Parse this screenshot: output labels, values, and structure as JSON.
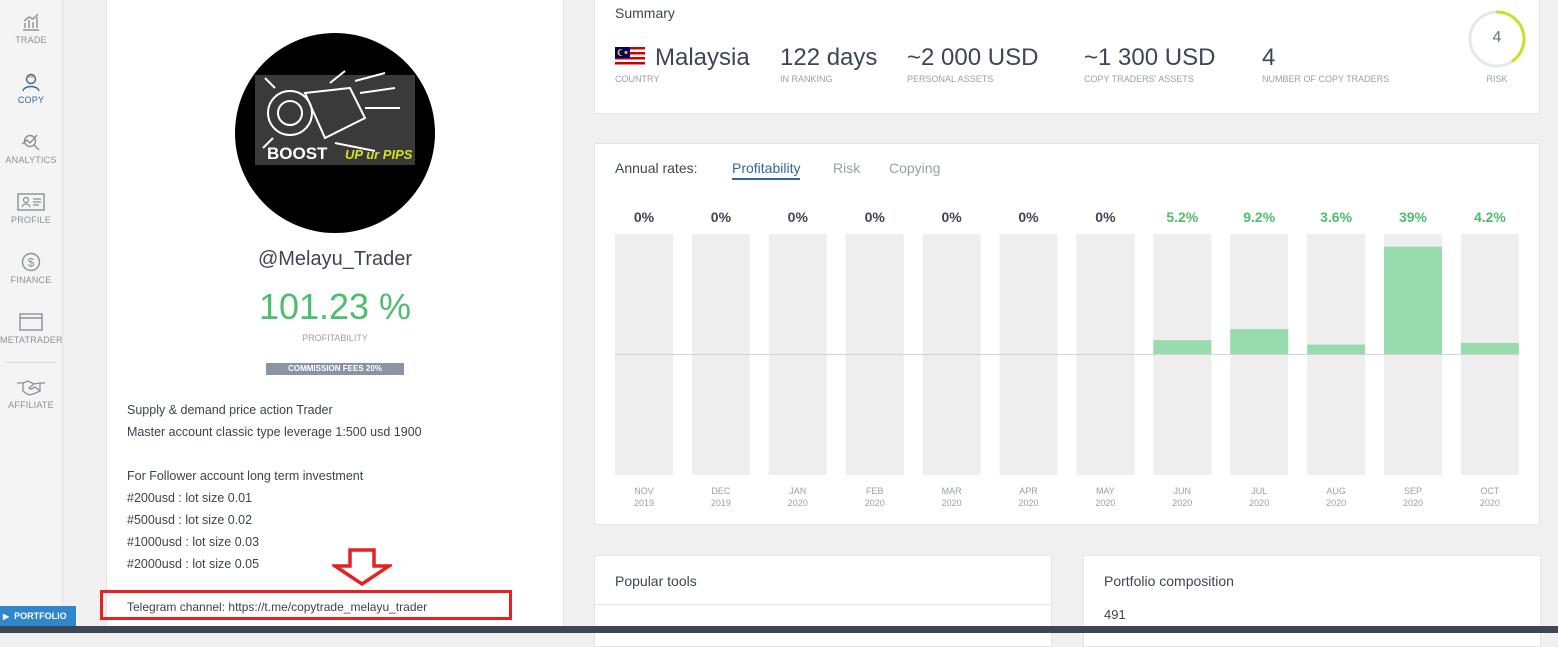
{
  "sidebar": {
    "items": [
      {
        "label": "TRADE",
        "icon": "chart-icon"
      },
      {
        "label": "COPY",
        "icon": "user-icon"
      },
      {
        "label": "ANALYTICS",
        "icon": "analytics-icon"
      },
      {
        "label": "PROFILE",
        "icon": "id-card-icon"
      },
      {
        "label": "FINANCE",
        "icon": "dollar-icon"
      },
      {
        "label": "METATRADER",
        "icon": "window-icon"
      },
      {
        "label": "AFFILIATE",
        "icon": "handshake-icon"
      }
    ],
    "active": "COPY",
    "portfolio_tab": "PORTFOLIO"
  },
  "profile": {
    "avatar_text_main": "BOOST",
    "avatar_text_accent": "UP ur PIPS",
    "username": "@Melayu_Trader",
    "profitability_value": "101.23 %",
    "profitability_label": "PROFITABILITY",
    "commission_badge": "COMMISSION FEES 20%",
    "bio": [
      "Supply & demand price action Trader",
      "Master account classic type leverage 1:500 usd 1900",
      "For Follower account long term investment",
      "#200usd : lot size 0.01",
      "#500usd : lot size 0.02",
      "#1000usd : lot size 0.03",
      "#2000usd : lot size 0.05"
    ],
    "telegram": "Telegram channel: https://t.me/copytrade_melayu_trader"
  },
  "summary": {
    "title": "Summary",
    "country_value": "Malaysia",
    "country_label": "COUNTRY",
    "ranking_value": "122 days",
    "ranking_label": "IN RANKING",
    "personal_assets_value": "~2 000 USD",
    "personal_assets_label": "PERSONAL ASSETS",
    "copy_assets_value": "~1 300 USD",
    "copy_assets_label": "COPY TRADERS' ASSETS",
    "copy_traders_value": "4",
    "copy_traders_label": "NUMBER OF COPY TRADERS",
    "risk_value": "4",
    "risk_label": "RISK",
    "risk_level": 0.4
  },
  "annual_rates": {
    "title": "Annual rates:",
    "tabs": [
      "Profitability",
      "Risk",
      "Copying"
    ],
    "active_tab": "Profitability"
  },
  "chart_data": {
    "type": "bar",
    "categories": [
      "NOV 2019",
      "DEC 2019",
      "JAN 2020",
      "FEB 2020",
      "MAR 2020",
      "APR 2020",
      "MAY 2020",
      "JUN 2020",
      "JUL 2020",
      "AUG 2020",
      "SEP 2020",
      "OCT 2020"
    ],
    "month_labels": [
      "NOV",
      "DEC",
      "JAN",
      "FEB",
      "MAR",
      "APR",
      "MAY",
      "JUN",
      "JUL",
      "AUG",
      "SEP",
      "OCT"
    ],
    "year_labels": [
      "2019",
      "2019",
      "2020",
      "2020",
      "2020",
      "2020",
      "2020",
      "2020",
      "2020",
      "2020",
      "2020",
      "2020"
    ],
    "values": [
      0,
      0,
      0,
      0,
      0,
      0,
      0,
      5.2,
      9.2,
      3.6,
      39,
      4.2
    ],
    "value_labels": [
      "0%",
      "0%",
      "0%",
      "0%",
      "0%",
      "0%",
      "0%",
      "5.2%",
      "9.2%",
      "3.6%",
      "39%",
      "4.2%"
    ],
    "ylim": [
      -43.6,
      43.6
    ],
    "positive_color": "#98dcae",
    "positive_label_color": "#4dbd6f",
    "zero_label_color": "#3d4654",
    "track_color": "#eeeeee"
  },
  "popular_tools": {
    "title": "Popular tools"
  },
  "portfolio": {
    "title": "Portfolio composition",
    "trades_value": "491"
  },
  "colors": {
    "accent": "#2d6aa0",
    "profit_green": "#4dbd6f",
    "annotation_red": "#e32222"
  }
}
